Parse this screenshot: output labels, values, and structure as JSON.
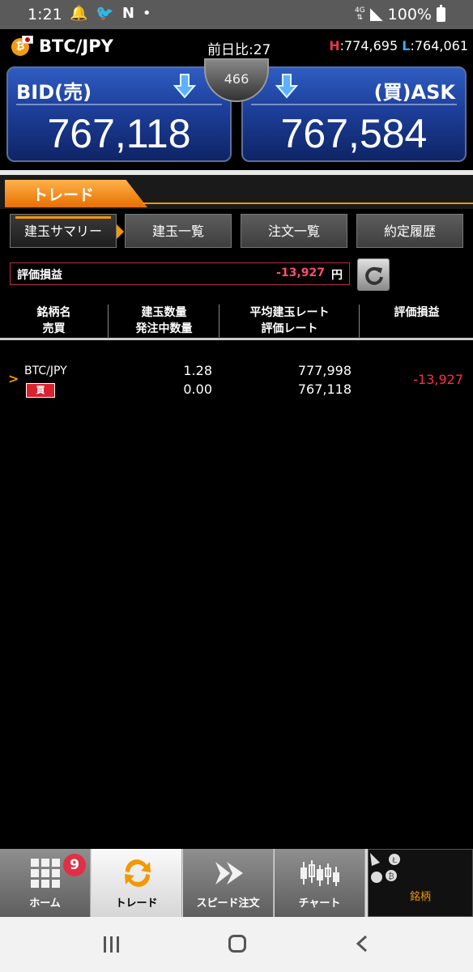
{
  "status_bar": {
    "time": "1:21",
    "network": "4G",
    "battery": "100%",
    "icons": [
      "bell-icon",
      "twitter-icon",
      "n-icon",
      "dot-icon"
    ]
  },
  "header": {
    "pair": "BTC/JPY",
    "prev_diff": "前日比:27",
    "high_label": "H",
    "high_value": ":774,695",
    "low_label": "L",
    "low_value": ":764,061"
  },
  "prices": {
    "bid_label": "BID(売)",
    "bid_price": "767,118",
    "ask_label": "(買)ASK",
    "ask_price": "767,584",
    "spread": "466"
  },
  "trade_tab": {
    "label": "トレード"
  },
  "subtabs": [
    {
      "label": "建玉サマリー",
      "active": true
    },
    {
      "label": "建玉一覧",
      "active": false
    },
    {
      "label": "注文一覧",
      "active": false
    },
    {
      "label": "約定履歴",
      "active": false
    }
  ],
  "pnl": {
    "label": "評価損益",
    "value": "-13,927",
    "unit": "円"
  },
  "table": {
    "headers": [
      [
        "銘柄名",
        "売買"
      ],
      [
        "建玉数量",
        "発注中数量"
      ],
      [
        "平均建玉レート",
        "評価レート"
      ],
      [
        "評価損益"
      ]
    ],
    "rows": [
      {
        "chevron": ">",
        "symbol": "BTC/JPY",
        "side": "買",
        "quantity": "1.28",
        "pending_quantity": "0.00",
        "avg_rate": "777,998",
        "eval_rate": "767,118",
        "pnl": "-13,927"
      }
    ]
  },
  "bottom_nav": {
    "home": {
      "label": "ホーム",
      "badge": "9"
    },
    "trade": {
      "label": "トレード"
    },
    "speed": {
      "label": "スピード注文"
    },
    "chart": {
      "label": "チャート"
    },
    "symbols": {
      "label": "銘柄"
    }
  },
  "colors": {
    "accent_orange": "#f39800",
    "negative_red": "#ff2d3f",
    "panel_blue": "#1d3f9a"
  }
}
